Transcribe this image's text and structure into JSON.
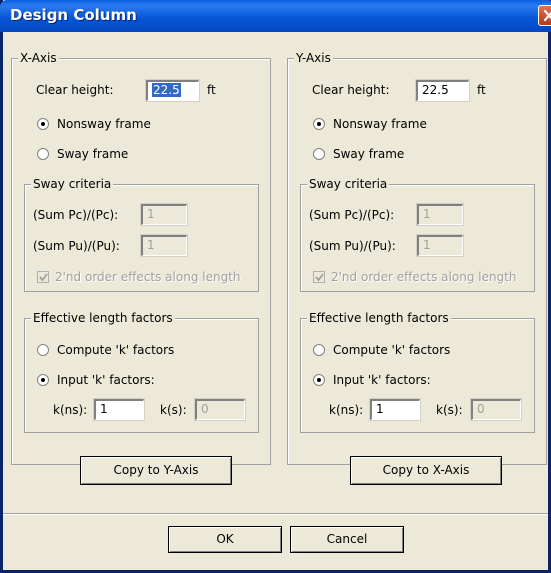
{
  "window": {
    "title": "Design Column"
  },
  "x_axis": {
    "panel_label": "X-Axis",
    "clear_height_label": "Clear height:",
    "clear_height_value": "22.5",
    "clear_height_unit": "ft",
    "nonsway_label": "Nonsway frame",
    "sway_label": "Sway frame",
    "frame_selected": "nonsway",
    "sway_criteria": {
      "label": "Sway criteria",
      "sum_pc_label": "(Sum Pc)/(Pc):",
      "sum_pc_value": "1",
      "sum_pu_label": "(Sum Pu)/(Pu):",
      "sum_pu_value": "1",
      "second_order_label": "2'nd order effects along length",
      "second_order_checked": true
    },
    "effective_length": {
      "label": "Effective length factors",
      "compute_label": "Compute 'k' factors",
      "input_label": "Input 'k' factors:",
      "selected": "input",
      "kns_label": "k(ns):",
      "kns_value": "1",
      "ks_label": "k(s):",
      "ks_value": "0"
    },
    "copy_button": "Copy to Y-Axis"
  },
  "y_axis": {
    "panel_label": "Y-Axis",
    "clear_height_label": "Clear height:",
    "clear_height_value": "22.5",
    "clear_height_unit": "ft",
    "nonsway_label": "Nonsway frame",
    "sway_label": "Sway frame",
    "frame_selected": "nonsway",
    "sway_criteria": {
      "label": "Sway criteria",
      "sum_pc_label": "(Sum Pc)/(Pc):",
      "sum_pc_value": "1",
      "sum_pu_label": "(Sum Pu)/(Pu):",
      "sum_pu_value": "1",
      "second_order_label": "2'nd order effects along length",
      "second_order_checked": true
    },
    "effective_length": {
      "label": "Effective length factors",
      "compute_label": "Compute 'k' factors",
      "input_label": "Input 'k' factors:",
      "selected": "input",
      "kns_label": "k(ns):",
      "kns_value": "1",
      "ks_label": "k(s):",
      "ks_value": "0"
    },
    "copy_button": "Copy to X-Axis"
  },
  "footer": {
    "ok_label": "OK",
    "cancel_label": "Cancel"
  },
  "icons": {
    "close": "close-icon",
    "check": "checkmark-icon"
  },
  "colors": {
    "title_bar": "#0a5fe0",
    "close_button": "#c94c2d",
    "dialog_bg": "#ece9d8",
    "selection": "#316ac5"
  }
}
